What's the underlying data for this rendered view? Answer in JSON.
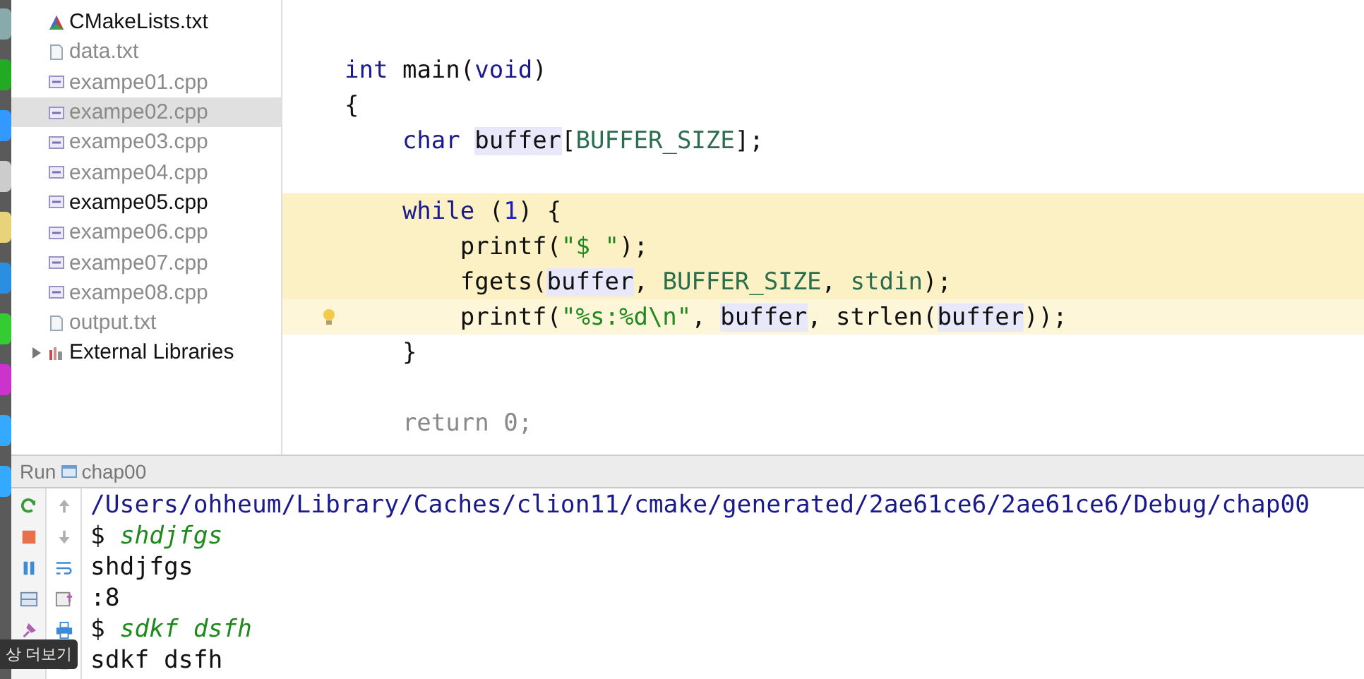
{
  "project_tree": {
    "items": [
      {
        "label": "CMakeLists.txt",
        "kind": "cmake",
        "selected": false,
        "open": true
      },
      {
        "label": "data.txt",
        "kind": "text",
        "selected": false,
        "open": false
      },
      {
        "label": "exampe01.cpp",
        "kind": "cpp",
        "selected": false,
        "open": false
      },
      {
        "label": "exampe02.cpp",
        "kind": "cpp",
        "selected": true,
        "open": false
      },
      {
        "label": "exampe03.cpp",
        "kind": "cpp",
        "selected": false,
        "open": false
      },
      {
        "label": "exampe04.cpp",
        "kind": "cpp",
        "selected": false,
        "open": false
      },
      {
        "label": "exampe05.cpp",
        "kind": "cpp",
        "selected": false,
        "open": true
      },
      {
        "label": "exampe06.cpp",
        "kind": "cpp",
        "selected": false,
        "open": false
      },
      {
        "label": "exampe07.cpp",
        "kind": "cpp",
        "selected": false,
        "open": false
      },
      {
        "label": "exampe08.cpp",
        "kind": "cpp",
        "selected": false,
        "open": false
      },
      {
        "label": "output.txt",
        "kind": "text",
        "selected": false,
        "open": false
      },
      {
        "label": "External Libraries",
        "kind": "library",
        "selected": false,
        "open": true,
        "expanded": false
      }
    ]
  },
  "editor": {
    "lines": [
      {
        "kind": "code",
        "highlighted": false,
        "current": false,
        "hint": false,
        "tokens": [
          {
            "text": "int",
            "kind": "keyword"
          },
          {
            "text": " main(",
            "kind": "plain"
          },
          {
            "text": "void",
            "kind": "keyword"
          },
          {
            "text": ")",
            "kind": "plain"
          }
        ]
      },
      {
        "kind": "code",
        "highlighted": false,
        "current": false,
        "hint": false,
        "tokens": [
          {
            "text": "{",
            "kind": "plain"
          }
        ]
      },
      {
        "kind": "code",
        "highlighted": false,
        "current": false,
        "hint": false,
        "tokens": [
          {
            "text": "    char ",
            "kind": "keyword"
          },
          {
            "text": "buffer",
            "kind": "usage"
          },
          {
            "text": "[",
            "kind": "plain"
          },
          {
            "text": "BUFFER_SIZE",
            "kind": "macro"
          },
          {
            "text": "];",
            "kind": "plain"
          }
        ]
      },
      {
        "kind": "blank",
        "highlighted": false,
        "current": false,
        "hint": false
      },
      {
        "kind": "code",
        "highlighted": true,
        "current": false,
        "hint": false,
        "tokens": [
          {
            "text": "    while",
            "kind": "keyword"
          },
          {
            "text": " (",
            "kind": "plain"
          },
          {
            "text": "1",
            "kind": "number"
          },
          {
            "text": ") {",
            "kind": "plain"
          }
        ]
      },
      {
        "kind": "code",
        "highlighted": true,
        "current": false,
        "hint": false,
        "tokens": [
          {
            "text": "        printf(",
            "kind": "plain"
          },
          {
            "text": "\"$ \"",
            "kind": "string"
          },
          {
            "text": ");",
            "kind": "plain"
          }
        ]
      },
      {
        "kind": "code",
        "highlighted": true,
        "current": false,
        "hint": false,
        "tokens": [
          {
            "text": "        fgets(",
            "kind": "plain"
          },
          {
            "text": "buffer",
            "kind": "usage"
          },
          {
            "text": ", ",
            "kind": "plain"
          },
          {
            "text": "BUFFER_SIZE",
            "kind": "macro"
          },
          {
            "text": ", ",
            "kind": "plain"
          },
          {
            "text": "stdin",
            "kind": "macro"
          },
          {
            "text": ");",
            "kind": "plain"
          }
        ]
      },
      {
        "kind": "code",
        "highlighted": true,
        "current": true,
        "hint": true,
        "tokens": [
          {
            "text": "        printf(",
            "kind": "plain"
          },
          {
            "text": "\"%s:%d\\n\"",
            "kind": "string"
          },
          {
            "text": ", ",
            "kind": "plain"
          },
          {
            "text": "buffer",
            "kind": "usage"
          },
          {
            "text": ", strlen(",
            "kind": "plain"
          },
          {
            "text": "buffer",
            "kind": "usage"
          },
          {
            "text": "));",
            "kind": "plain"
          }
        ]
      },
      {
        "kind": "code",
        "highlighted": false,
        "current": false,
        "hint": false,
        "tokens": [
          {
            "text": "    }",
            "kind": "plain"
          }
        ]
      },
      {
        "kind": "blank",
        "highlighted": false,
        "current": false,
        "hint": false
      },
      {
        "kind": "code",
        "highlighted": false,
        "current": false,
        "hint": false,
        "tokens": [
          {
            "text": "    return 0;",
            "kind": "unused"
          }
        ]
      }
    ]
  },
  "run_panel": {
    "label": "Run",
    "config": "chap00",
    "lines": [
      {
        "tokens": [
          {
            "text": "/Users/ohheum/Library/Caches/clion11/cmake/generated/2ae61ce6/2ae61ce6/Debug/chap00",
            "kind": "path"
          }
        ]
      },
      {
        "tokens": [
          {
            "text": "$ ",
            "kind": "output"
          },
          {
            "text": "shdjfgs",
            "kind": "input"
          }
        ]
      },
      {
        "tokens": [
          {
            "text": "shdjfgs",
            "kind": "output"
          }
        ]
      },
      {
        "tokens": [
          {
            "text": ":8",
            "kind": "output"
          }
        ]
      },
      {
        "tokens": [
          {
            "text": "$ ",
            "kind": "output"
          },
          {
            "text": "sdkf dsfh",
            "kind": "input"
          }
        ]
      },
      {
        "tokens": [
          {
            "text": "sdkf dsfh",
            "kind": "output"
          }
        ]
      }
    ]
  },
  "tooltip": {
    "text": "상 더보기"
  }
}
